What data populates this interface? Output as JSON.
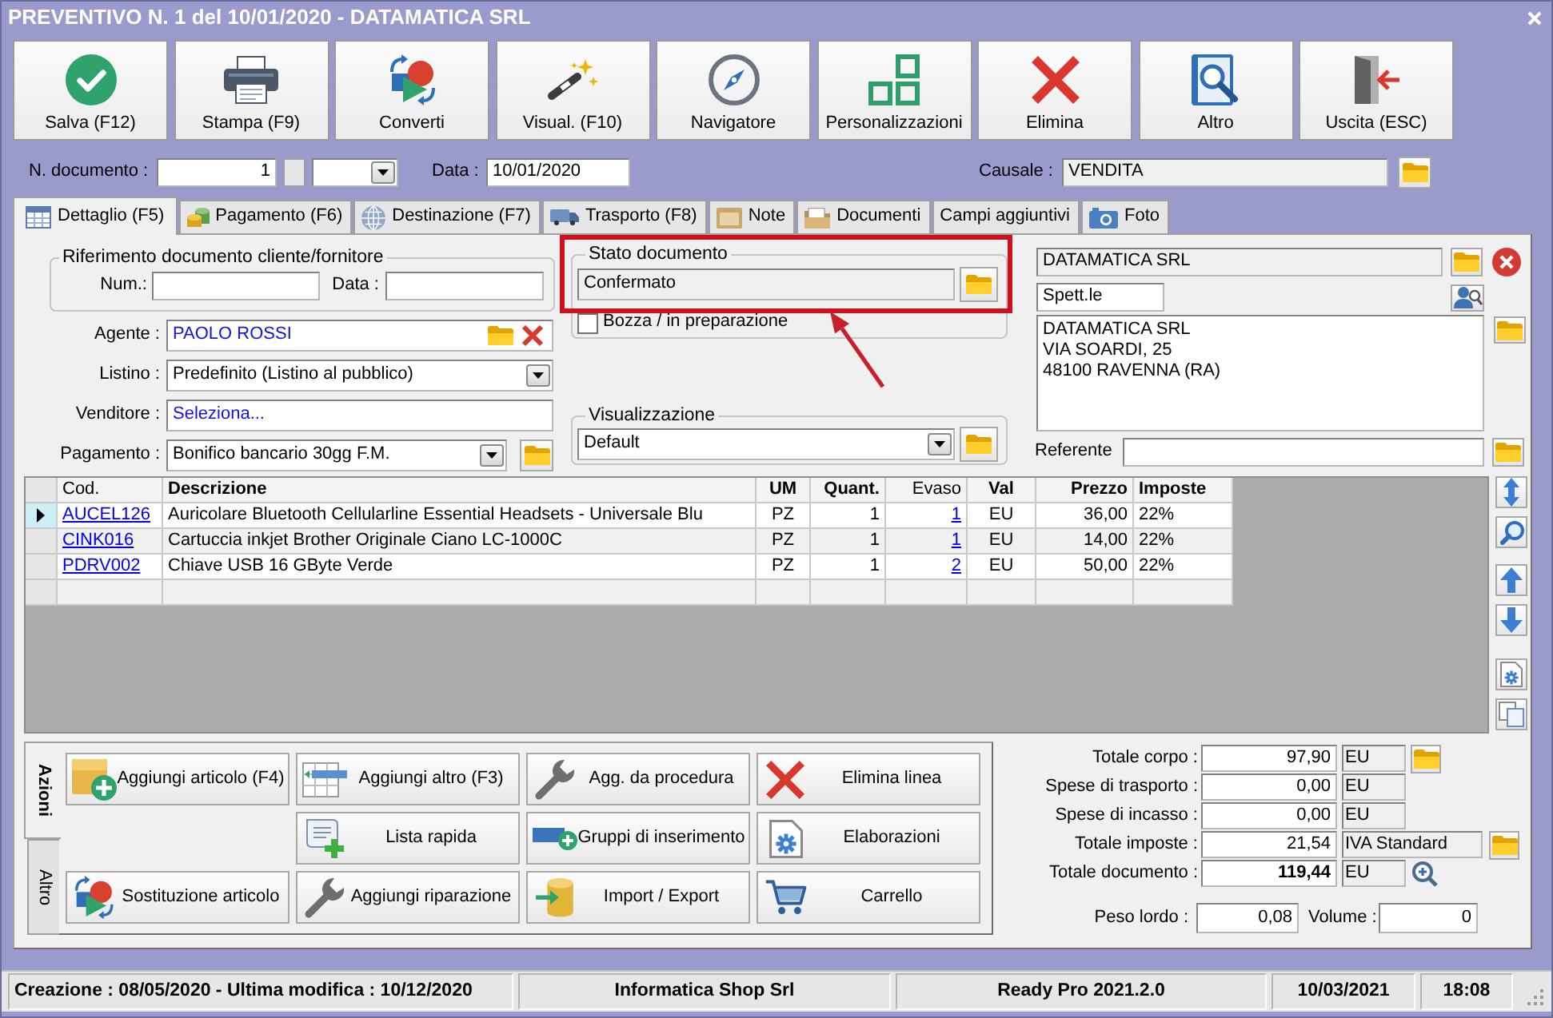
{
  "window": {
    "title": "PREVENTIVO N. 1 del 10/01/2020 - DATAMATICA SRL"
  },
  "toolbar": [
    "Salva (F12)",
    "Stampa (F9)",
    "Converti",
    "Visual. (F10)",
    "Navigatore",
    "Personalizzazioni",
    "Elimina",
    "Altro",
    "Uscita (ESC)"
  ],
  "document": {
    "number_label": "N. documento :",
    "number": "1",
    "date_label": "Data :",
    "date": "10/01/2020",
    "reason_label": "Causale :",
    "reason": "VENDITA"
  },
  "tabs": [
    {
      "label": "Dettaglio (F5)",
      "selected": true
    },
    {
      "label": "Pagamento (F6)",
      "selected": false
    },
    {
      "label": "Destinazione (F7)",
      "selected": false
    },
    {
      "label": "Trasporto (F8)",
      "selected": false
    },
    {
      "label": "Note",
      "selected": false
    },
    {
      "label": "Documenti",
      "selected": false
    },
    {
      "label": "Campi aggiuntivi",
      "selected": false
    },
    {
      "label": "Foto",
      "selected": false
    }
  ],
  "reference": {
    "title": "Riferimento documento cliente/fornitore",
    "number_label": "Num.:",
    "date_label": "Data :"
  },
  "fields": [
    {
      "label": "Agente :",
      "value": "PAOLO ROSSI",
      "kind": "lookup"
    },
    {
      "label": "Listino :",
      "value": "Predefinito (Listino al pubblico)",
      "kind": "select"
    },
    {
      "label": "Venditore :",
      "value": "Seleziona...",
      "kind": "entry"
    },
    {
      "label": "Pagamento :",
      "value": "Bonifico bancario 30gg F.M.",
      "kind": "combo"
    }
  ],
  "status": {
    "title": "Stato documento",
    "value": "Confermato",
    "highlighted": true,
    "draft_label": "Bozza / in preparazione",
    "draft_checked": false
  },
  "view": {
    "title": "Visualizzazione",
    "value": "Default"
  },
  "customer": {
    "name": "DATAMATICA SRL",
    "salutation": "Spett.le",
    "address_lines": [
      "DATAMATICA SRL",
      "VIA SOARDI, 25",
      "48100 RAVENNA (RA)"
    ],
    "contact_label": "Referente"
  },
  "table": {
    "columns": [
      {
        "label": "Cod.",
        "kind": "link"
      },
      {
        "label": "Descrizione",
        "kind": "text"
      },
      {
        "label": "UM",
        "kind": "text"
      },
      {
        "label": "Quant.",
        "kind": "text"
      },
      {
        "label": "Evaso",
        "kind": "link"
      },
      {
        "label": "Val",
        "kind": "text"
      },
      {
        "label": "Prezzo",
        "kind": "text"
      },
      {
        "label": "Imposte",
        "kind": "text"
      }
    ],
    "rows": [
      {
        "selected": true,
        "cells": [
          "AUCEL126",
          "Auricolare Bluetooth Cellularline Essential Headsets - Universale Blu",
          "PZ",
          "1",
          "1",
          "EU",
          "36,00",
          "22%"
        ]
      },
      {
        "selected": false,
        "cells": [
          "CINK016",
          "Cartuccia inkjet Brother Originale Ciano LC-1000C",
          "PZ",
          "1",
          "1",
          "EU",
          "14,00",
          "22%"
        ]
      },
      {
        "selected": false,
        "cells": [
          "PDRV002",
          "Chiave USB 16 GByte Verde",
          "PZ",
          "1",
          "2",
          "EU",
          "50,00",
          "22%"
        ]
      }
    ]
  },
  "action_tabs": [
    {
      "label": "Azioni",
      "selected": true
    },
    {
      "label": "Altro",
      "selected": false
    }
  ],
  "actions": [
    [
      "Aggiungi articolo (F4)",
      "Aggiungi altro (F3)",
      "Agg. da procedura",
      "Elimina linea"
    ],
    [
      "Lista rapida",
      "Gruppi di inserimento",
      "Elaborazioni"
    ],
    [
      "Sostituzione articolo",
      "Aggiungi riparazione",
      "Import / Export",
      "Carrello"
    ]
  ],
  "totals": [
    {
      "label": "Totale corpo :",
      "value": "97,90",
      "unit": "EU",
      "kind": "folder"
    },
    {
      "label": "Spese di trasporto :",
      "value": "0,00",
      "unit": "EU",
      "kind": "plain"
    },
    {
      "label": "Spese di incasso :",
      "value": "0,00",
      "unit": "EU",
      "kind": "plain"
    },
    {
      "label": "Totale imposte :",
      "value": "21,54",
      "unit": "IVA Standard",
      "kind": "wide"
    },
    {
      "label": "Totale documento :",
      "value": "119,44",
      "unit": "EU",
      "kind": "grand"
    }
  ],
  "weights": {
    "gross_label": "Peso lordo :",
    "gross": "0,08",
    "volume_label": "Volume :",
    "volume": "0"
  },
  "status_bar": [
    "Creazione : 08/05/2020 - Ultima modifica : 10/12/2020",
    "Informatica Shop Srl",
    "Ready Pro 2021.2.0",
    "10/03/2021",
    "18:08"
  ]
}
